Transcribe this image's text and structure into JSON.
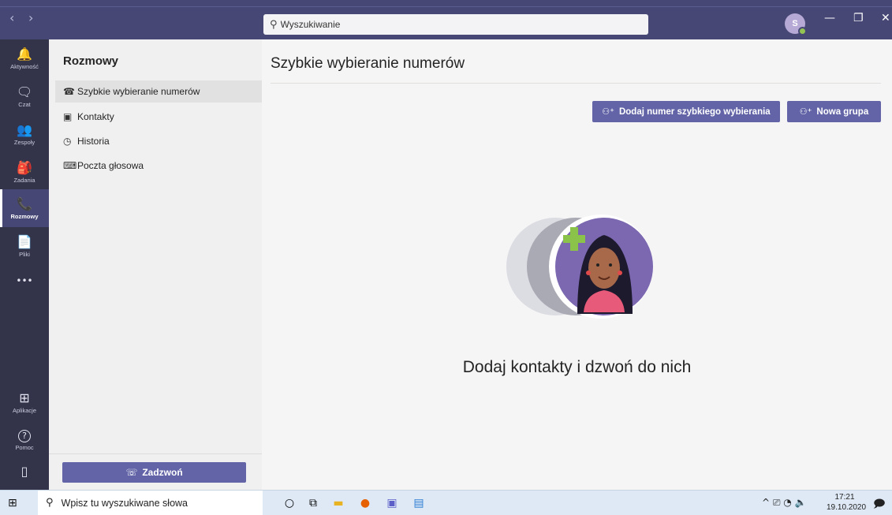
{
  "titlebar": {
    "back_glyph": "‹",
    "forward_glyph": "›",
    "search_placeholder": "Wyszukiwanie",
    "avatar_initial": "S",
    "minimize_glyph": "—",
    "maximize_glyph": "❐",
    "close_glyph": "✕"
  },
  "rail": {
    "items": [
      {
        "label": "Aktywność",
        "icon": "bell-icon",
        "glyph": "🔔"
      },
      {
        "label": "Czat",
        "icon": "chat-icon",
        "glyph": "🗨"
      },
      {
        "label": "Zespoły",
        "icon": "teams-icon",
        "glyph": "👥"
      },
      {
        "label": "Zadania",
        "icon": "tasks-icon",
        "glyph": "🎒"
      },
      {
        "label": "Rozmowy",
        "icon": "phone-icon",
        "glyph": "📞"
      },
      {
        "label": "Pliki",
        "icon": "files-icon",
        "glyph": "📄"
      },
      {
        "label": "",
        "icon": "more-icon",
        "glyph": "•••"
      },
      {
        "label": "Aplikacje",
        "icon": "apps-icon",
        "glyph": "⊞"
      },
      {
        "label": "Pomoc",
        "icon": "help-icon",
        "glyph": "?"
      },
      {
        "label": "",
        "icon": "device-icon",
        "glyph": "▯"
      }
    ]
  },
  "listpane": {
    "title": "Rozmowy",
    "items": [
      {
        "label": "Szybkie wybieranie numerów",
        "icon": "phone-icon",
        "glyph": "☎"
      },
      {
        "label": "Kontakty",
        "icon": "contacts-icon",
        "glyph": "▣"
      },
      {
        "label": "Historia",
        "icon": "history-icon",
        "glyph": "◷"
      },
      {
        "label": "Poczta głosowa",
        "icon": "voicemail-icon",
        "glyph": "⌨"
      }
    ],
    "call_button": "Zadzwoń",
    "call_glyph": "☏"
  },
  "main": {
    "title": "Szybkie wybieranie numerów",
    "add_speed_dial_button": "Dodaj numer szybkiego wybierania",
    "new_group_button": "Nowa grupa",
    "add_glyph": "⚇⁺",
    "empty_title": "Dodaj kontakty i dzwoń do nich"
  },
  "taskbar": {
    "start_glyph": "⊞",
    "search_placeholder": "Wpisz tu wyszukiwane słowa",
    "search_glyph": "⚲",
    "apps": [
      {
        "icon": "cortana-icon",
        "glyph": "○",
        "color": "#111111"
      },
      {
        "icon": "task-view-icon",
        "glyph": "⧉",
        "color": "#111111"
      },
      {
        "icon": "file-explorer-icon",
        "glyph": "▬",
        "color": "#e8b323"
      },
      {
        "icon": "firefox-icon",
        "glyph": "●",
        "color": "#e66000"
      },
      {
        "icon": "teams-app-icon",
        "glyph": "▣",
        "color": "#5b5fc7"
      },
      {
        "icon": "document-icon",
        "glyph": "▤",
        "color": "#2b7cd3"
      }
    ],
    "tray": "^  ⎚  ◔  🔈",
    "time": "17:21",
    "date": "19.10.2020",
    "notification_glyph": "🗩"
  },
  "colors": {
    "accent": "#6264a7",
    "titlebar": "#464775",
    "rail": "#33344a",
    "status_available": "#92c353"
  }
}
